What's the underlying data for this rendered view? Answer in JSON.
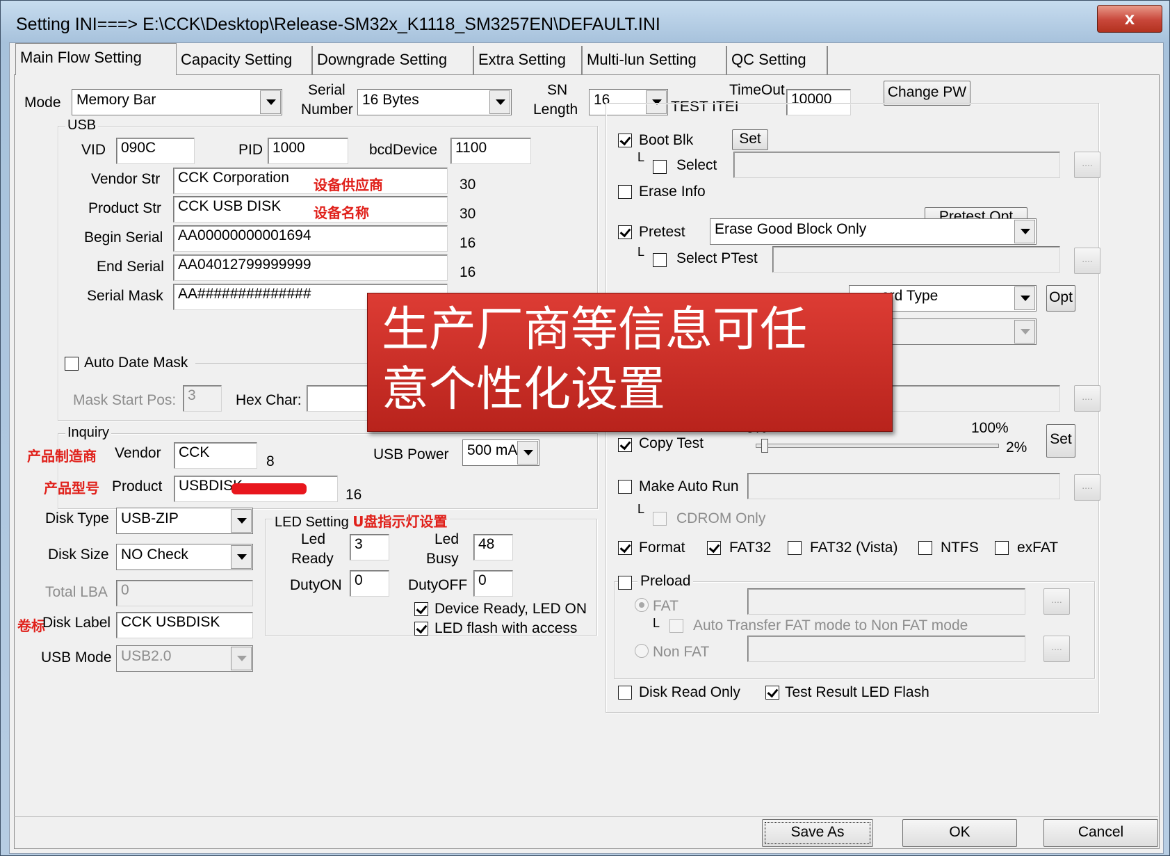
{
  "window": {
    "title": "Setting  INI===> E:\\CCK\\Desktop\\Release-SM32x_K1118_SM3257EN\\DEFAULT.INI",
    "close_label": "x"
  },
  "tabs": [
    "Main Flow Setting",
    "Capacity Setting",
    "Downgrade Setting",
    "Extra Setting",
    "Multi-lun Setting",
    "QC Setting"
  ],
  "top": {
    "mode_label": "Mode",
    "mode_value": "Memory Bar",
    "serial_label_1": "Serial",
    "serial_label_2": "Number",
    "serial_value": "16 Bytes",
    "sn_label_1": "SN",
    "sn_label_2": "Length",
    "sn_value": "16",
    "test_item_label": "TEST ITEI",
    "timeout_label": "TimeOut",
    "timeout_value": "10000",
    "change_pw": "Change PW"
  },
  "usb": {
    "group_title": "USB",
    "vid_label": "VID",
    "vid": "090C",
    "pid_label": "PID",
    "pid": "1000",
    "bcd_label": "bcdDevice",
    "bcd": "1100",
    "vendor_str_label": "Vendor Str",
    "vendor_str": "CCK Corporation",
    "vendor_str_len": "30",
    "vendor_str_note": "设备供应商",
    "product_str_label": "Product Str",
    "product_str": "CCK USB DISK",
    "product_str_len": "30",
    "product_str_note": "设备名称",
    "begin_serial_label": "Begin Serial",
    "begin_serial": "AA00000000001694",
    "begin_serial_len": "16",
    "end_serial_label": "End Serial",
    "end_serial": "AA04012799999999",
    "end_serial_len": "16",
    "serial_mask_label": "Serial Mask",
    "serial_mask": "AA##############",
    "auto_date_mask": "Auto Date Mask",
    "mask_start_label": "Mask Start Pos:",
    "mask_start": "3",
    "hex_char_label": "Hex Char:"
  },
  "inquiry": {
    "group_title": "Inquiry",
    "vendor_note": "产品制造商",
    "vendor_label": "Vendor",
    "vendor": "CCK",
    "vendor_len": "8",
    "product_note": "产品型号",
    "product_label": "Product",
    "product": "USBDISK",
    "product_len": "16",
    "usb_power_label": "USB Power",
    "usb_power": "500 mA"
  },
  "disk": {
    "type_label": "Disk Type",
    "type": "USB-ZIP",
    "size_label": "Disk Size",
    "size": "NO Check",
    "lba_label": "Total LBA",
    "lba": "0",
    "label_note": "卷标",
    "label_label": "Disk Label",
    "label": "CCK USBDISK",
    "mode_label": "USB Mode",
    "mode": "USB2.0"
  },
  "led": {
    "group_title": "LED Setting",
    "note": "U盘指示灯设置",
    "ready_label_1": "Led",
    "ready_label_2": "Ready",
    "ready": "3",
    "busy_label_1": "Led",
    "busy_label_2": "Busy",
    "busy": "48",
    "dutyon_label": "DutyON",
    "dutyon": "0",
    "dutyoff_label": "DutyOFF",
    "dutyoff": "0",
    "device_ready": "Device Ready, LED ON",
    "flash_access": "LED flash with access"
  },
  "right": {
    "boot_blk": "Boot Blk",
    "set": "Set",
    "select": "Select",
    "ellipsis": "....",
    "erase_info": "Erase Info",
    "pretest_opt": "Pretest Opt",
    "pretest": "Pretest",
    "pretest_value": "Erase Good Block Only",
    "select_ptest": "Select PTest",
    "card_type_partial": "ard Type",
    "opt": "Opt",
    "copy_test": "Copy Test",
    "pct_0": "0%",
    "pct_100": "100%",
    "copy_value": "2%",
    "make_auto_run": "Make Auto Run",
    "cdrom_only": "CDROM Only",
    "format": "Format",
    "fat32": "FAT32",
    "fat32_vista": "FAT32 (Vista)",
    "ntfs": "NTFS",
    "exfat": "exFAT",
    "preload": "Preload",
    "fat": "FAT",
    "auto_transfer": "Auto Transfer FAT mode to Non FAT mode",
    "non_fat": "Non FAT",
    "disk_read_only": "Disk Read Only",
    "test_result_led": "Test Result LED Flash"
  },
  "slider": {
    "copy_test_level_percent": 2
  },
  "footer": {
    "save_as": "Save As",
    "ok": "OK",
    "cancel": "Cancel"
  },
  "banner": {
    "line1": "生产厂商等信息可任",
    "line2": "意个性化设置"
  }
}
